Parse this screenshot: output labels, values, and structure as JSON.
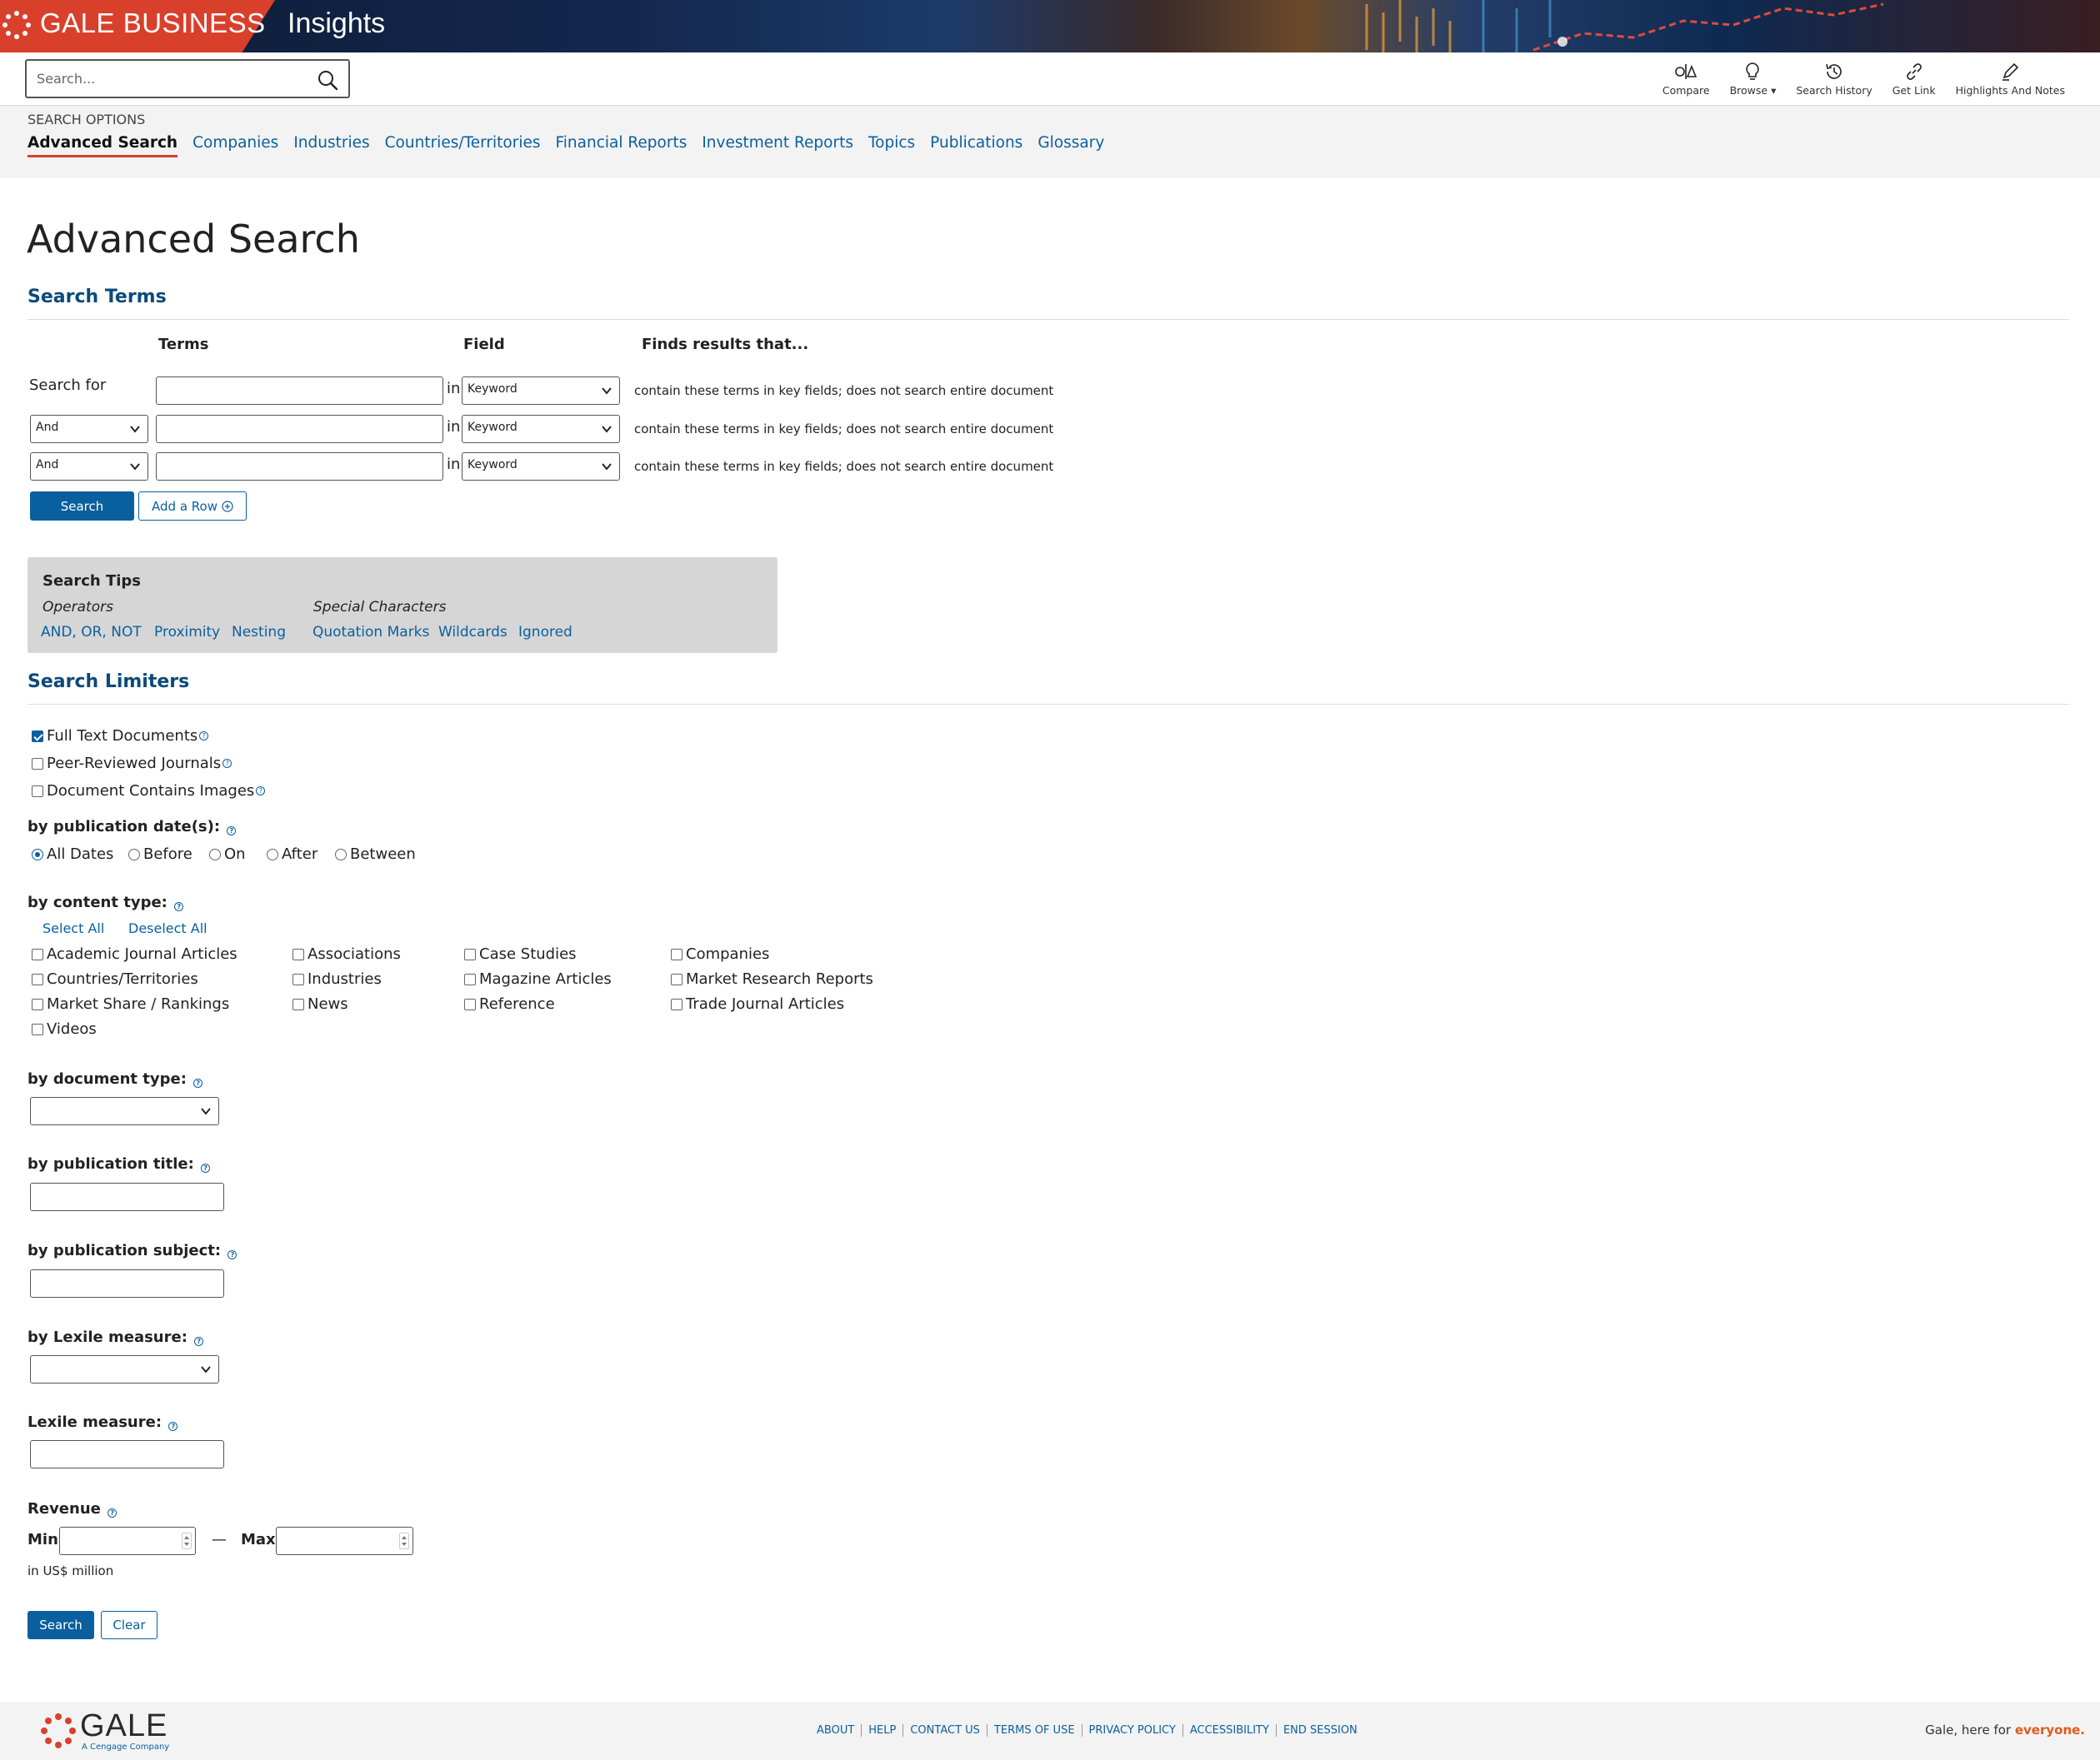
{
  "banner": {
    "brand_name": "GALE BUSINESS",
    "product_name": "Insights"
  },
  "toolbar": {
    "search_placeholder": "Search...",
    "tools": [
      {
        "label": "Compare",
        "icon": "compare-icon"
      },
      {
        "label": "Browse ▾",
        "icon": "lightbulb-icon"
      },
      {
        "label": "Search History",
        "icon": "history-icon"
      },
      {
        "label": "Get Link",
        "icon": "link-icon"
      },
      {
        "label": "Highlights And Notes",
        "icon": "pen-icon"
      }
    ]
  },
  "search_options": {
    "label": "SEARCH OPTIONS",
    "tabs": [
      "Advanced Search",
      "Companies",
      "Industries",
      "Countries/Territories",
      "Financial Reports",
      "Investment Reports",
      "Topics",
      "Publications",
      "Glossary"
    ],
    "active": "Advanced Search"
  },
  "main": {
    "title": "Advanced Search",
    "search_terms": {
      "heading": "Search Terms",
      "col_terms": "Terms",
      "col_field": "Field",
      "col_finds": "Finds results that...",
      "row1_label": "Search for",
      "in_label": "in",
      "rows": [
        {
          "operator": "",
          "term": "",
          "field": "Keyword",
          "desc": "contain these terms in key fields; does not search entire document"
        },
        {
          "operator": "And",
          "term": "",
          "field": "Keyword",
          "desc": "contain these terms in key fields; does not search entire document"
        },
        {
          "operator": "And",
          "term": "",
          "field": "Keyword",
          "desc": "contain these terms in key fields; does not search entire document"
        }
      ],
      "search_button": "Search",
      "add_row_button": "Add a Row"
    },
    "tips": {
      "heading": "Search Tips",
      "operators_label": "Operators",
      "operators": [
        "AND, OR, NOT",
        "Proximity",
        "Nesting"
      ],
      "special_label": "Special Characters",
      "special": [
        "Quotation Marks",
        "Wildcards",
        "Ignored"
      ]
    },
    "limiters": {
      "heading": "Search Limiters",
      "checks": [
        {
          "label": "Full Text Documents",
          "checked": true
        },
        {
          "label": "Peer-Reviewed Journals",
          "checked": false
        },
        {
          "label": "Document Contains Images",
          "checked": false
        }
      ],
      "pubdate_label": "by publication date(s):",
      "pubdate_options": [
        "All Dates",
        "Before",
        "On",
        "After",
        "Between"
      ],
      "pubdate_selected": "All Dates",
      "content_label": "by content type:",
      "select_all": "Select All",
      "deselect_all": "Deselect All",
      "content_types": [
        [
          "Academic Journal Articles",
          "Associations",
          "Case Studies",
          "Companies"
        ],
        [
          "Countries/Territories",
          "Industries",
          "Magazine Articles",
          "Market Research Reports"
        ],
        [
          "Market Share / Rankings",
          "News",
          "Reference",
          "Trade Journal Articles"
        ],
        [
          "Videos"
        ]
      ],
      "doctype_label": "by document type:",
      "doctype_value": "",
      "pubtitle_label": "by publication title:",
      "pubtitle_value": "",
      "pubsubject_label": "by publication subject:",
      "pubsubject_value": "",
      "lexile_label": "by Lexile measure:",
      "lexile_value": "",
      "lexile_measure_label": "Lexile measure:",
      "lexile_measure_value": "",
      "revenue_label": "Revenue",
      "min_label": "Min",
      "dash": "—",
      "max_label": "Max",
      "min_value": "",
      "max_value": "",
      "unit": "in US$ million",
      "search_button": "Search",
      "clear_button": "Clear"
    }
  },
  "footer": {
    "logo_name": "GALE",
    "logo_sub": "A Cengage Company",
    "links": [
      "ABOUT",
      "HELP",
      "CONTACT US",
      "TERMS OF USE",
      "PRIVACY POLICY",
      "ACCESSIBILITY",
      "END SESSION"
    ],
    "tagline_prefix": "Gale, here for ",
    "tagline_emph": "everyone."
  },
  "colors": {
    "accent_red": "#d9402b",
    "link_blue": "#0a5f9e",
    "heading_blue": "#0b4a7a",
    "tips_bg": "#d6d6d6"
  }
}
